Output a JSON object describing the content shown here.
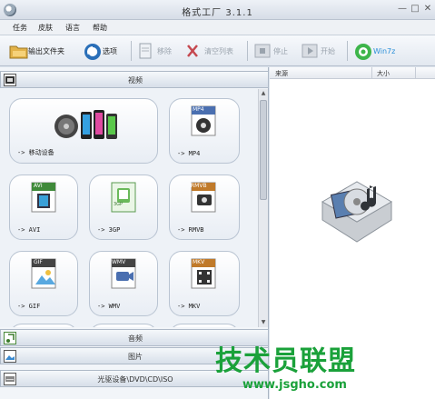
{
  "window": {
    "title": "格式工厂  3.1.1"
  },
  "menu": [
    "任务",
    "皮肤",
    "语言",
    "帮助"
  ],
  "toolbar": {
    "output_folder": "输出文件夹",
    "options": "选项",
    "remove": "移除",
    "clear_list": "清空列表",
    "stop": "停止",
    "start": "开始",
    "win7z": "Win7z"
  },
  "categories": {
    "video": "视频",
    "audio": "音频",
    "picture": "图片",
    "rom": "光驱设备\\DVD\\CD\\ISO"
  },
  "tiles": [
    {
      "label": "-> 移动设备",
      "icon": "mobile-devices-icon"
    },
    {
      "label": "-> MP4",
      "badge": "MP4"
    },
    {
      "label": "-> AVI",
      "badge": "AVI"
    },
    {
      "label": "-> 3GP",
      "badge": "3GP"
    },
    {
      "label": "-> RMVB",
      "badge": "RMVB"
    },
    {
      "label": "-> GIF",
      "badge": "GIF"
    },
    {
      "label": "-> WMV",
      "badge": "WMV"
    },
    {
      "label": "-> MKV",
      "badge": "MKV"
    }
  ],
  "task_list": {
    "col_source": "来源",
    "col_size": "大小"
  },
  "watermark": {
    "text": "技术员联盟",
    "url": "www.jsgho.com"
  },
  "colors": {
    "accent": "#2a8fd8",
    "watermark_green": "#1aa13a"
  }
}
